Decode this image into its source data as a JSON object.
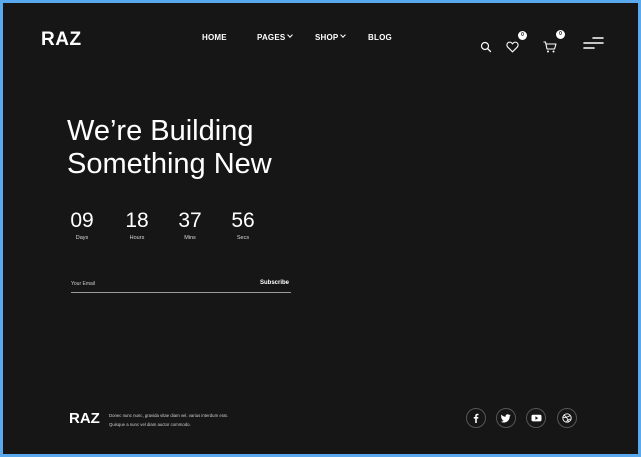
{
  "header": {
    "logo": "RAZ",
    "nav": [
      {
        "label": "HOME"
      },
      {
        "label": "PAGES"
      },
      {
        "label": "SHOP"
      },
      {
        "label": "BLOG"
      }
    ],
    "icons": {
      "search": "search-icon",
      "wishlist": "heart-icon",
      "cart": "cart-icon",
      "menu": "menu-icon"
    },
    "wishlist_count": "0",
    "cart_count": "0"
  },
  "hero": {
    "title_line1": "We’re Building",
    "title_line2": "Something New"
  },
  "countdown": [
    {
      "value": "09",
      "unit": "Days"
    },
    {
      "value": "18",
      "unit": "Hours"
    },
    {
      "value": "37",
      "unit": "Mins"
    },
    {
      "value": "56",
      "unit": "Secs"
    }
  ],
  "subscribe": {
    "placeholder": "Your Email",
    "button_label": "Subscribe"
  },
  "footer": {
    "logo": "RAZ",
    "text_line1": "Donec nunc nunc, gravida vitae diam vel, varius interdum erat.",
    "text_line2": "Quisque a nunc vel diam auctor commodo.",
    "social": [
      "facebook-icon",
      "twitter-icon",
      "youtube-icon",
      "dribbble-icon"
    ]
  },
  "colors": {
    "background": "#161616",
    "text": "#ffffff",
    "frame": "#5aa9ee"
  }
}
